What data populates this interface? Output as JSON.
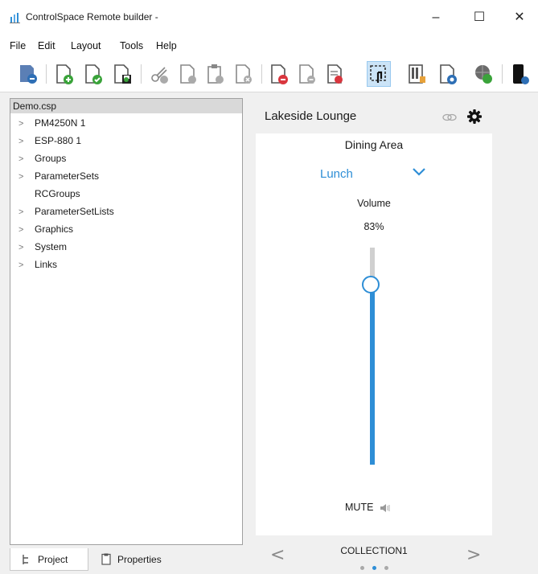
{
  "window": {
    "title": "ControlSpace Remote builder -",
    "minimize_glyph": "–",
    "maximize_glyph": "☐",
    "close_glyph": "✕"
  },
  "menu": [
    "File",
    "Edit",
    "Layout",
    "Tools",
    "Help"
  ],
  "toolbar": {
    "icons": [
      "app-settings-icon",
      "new-page-icon",
      "open-icon",
      "save-icon",
      "cut-icon",
      "copy-icon",
      "paste-icon",
      "delete-icon",
      "remove-red-icon",
      "remove-grey-icon",
      "edit-red-icon",
      "select-touch-icon",
      "layout-grid-icon",
      "add-blue-icon",
      "globe-icon",
      "device-preview-icon"
    ]
  },
  "tree": {
    "root": "Demo.csp",
    "items": [
      {
        "label": "PM4250N 1",
        "expandable": true
      },
      {
        "label": "ESP-880 1",
        "expandable": true
      },
      {
        "label": "Groups",
        "expandable": true
      },
      {
        "label": "ParameterSets",
        "expandable": true
      },
      {
        "label": "RCGroups",
        "expandable": false
      },
      {
        "label": "ParameterSetLists",
        "expandable": true
      },
      {
        "label": "Graphics",
        "expandable": true
      },
      {
        "label": "System",
        "expandable": true
      },
      {
        "label": "Links",
        "expandable": true
      }
    ]
  },
  "bottom_tabs": {
    "project": "Project",
    "properties": "Properties"
  },
  "preview": {
    "zone_title": "Lakeside Lounge",
    "area": "Dining Area",
    "preset": "Lunch",
    "volume_label": "Volume",
    "volume_value": "83%",
    "volume_level": 0.83,
    "mute_label": "MUTE",
    "collection": "COLLECTION1",
    "page_index": 1,
    "page_count": 3,
    "accent_color": "#2e8ed6"
  }
}
